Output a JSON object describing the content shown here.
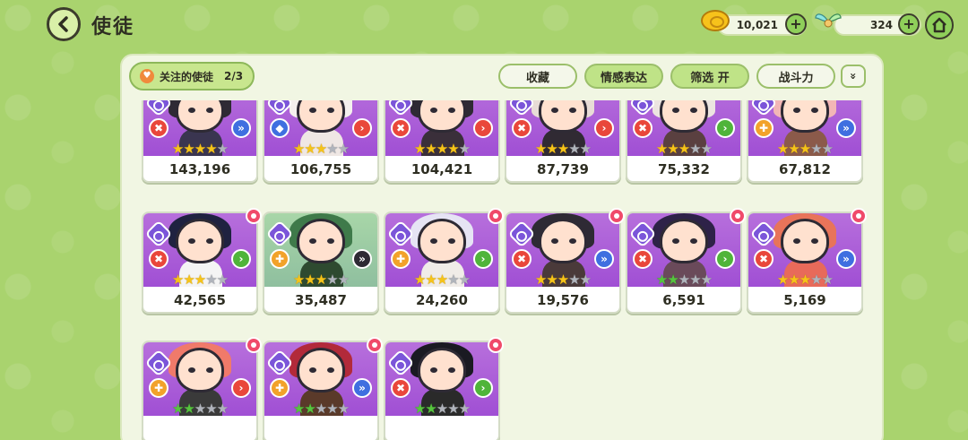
{
  "header": {
    "title": "使徒",
    "coins": "10,021",
    "gems": "324",
    "plus_label": "+"
  },
  "toolbar": {
    "follow_label": "关注的使徒",
    "follow_count": "2/3",
    "favorites_label": "收藏",
    "emotion_label": "情感表达",
    "filter_label": "筛选 开",
    "power_label": "战斗力",
    "collapse_label": "»"
  },
  "colors": {
    "accent_green": "#a9d36e",
    "card_purple": "#a04fd4",
    "star_gold": "#f6c419",
    "star_green": "#56c43e"
  },
  "cards": [
    {
      "power": "143,196",
      "stars_filled": 4,
      "star_color": "gold",
      "role": "atk",
      "arrow": "blue",
      "hair": "#2e2a34",
      "body": "#3a3550",
      "flower": false
    },
    {
      "power": "106,755",
      "stars_filled": 3,
      "star_color": "gold",
      "role": "def",
      "arrow": "red",
      "hair": "#f4f0ee",
      "body": "#efe7e4",
      "flower": false
    },
    {
      "power": "104,421",
      "stars_filled": 4,
      "star_color": "gold",
      "role": "atk",
      "arrow": "red",
      "hair": "#2e2a34",
      "body": "#3a2f3a",
      "flower": false
    },
    {
      "power": "87,739",
      "stars_filled": 3,
      "star_color": "gold",
      "role": "atk",
      "arrow": "red",
      "hair": "#e8dcd6",
      "body": "#302a33",
      "flower": false
    },
    {
      "power": "75,332",
      "stars_filled": 3,
      "star_color": "gold",
      "role": "atk",
      "arrow": "green",
      "hair": "#ece4e0",
      "body": "#5a4040",
      "flower": false
    },
    {
      "power": "67,812",
      "stars_filled": 3,
      "star_color": "gold",
      "role": "sup",
      "arrow": "blue",
      "hair": "#f2b6b6",
      "body": "#8b5a4a",
      "flower": false
    },
    {
      "power": "42,565",
      "stars_filled": 3,
      "star_color": "gold",
      "role": "atk",
      "arrow": "green",
      "hair": "#1f2240",
      "body": "#f4f4f4",
      "flower": true
    },
    {
      "power": "35,487",
      "stars_filled": 3,
      "star_color": "gold",
      "role": "sup",
      "arrow": "dark",
      "hair": "#3f7a4a",
      "body": "#2e4a30",
      "flower": false,
      "green_bg": true
    },
    {
      "power": "24,260",
      "stars_filled": 3,
      "star_color": "gold",
      "role": "sup",
      "arrow": "green",
      "hair": "#e6e4f4",
      "body": "#f0ece8",
      "flower": true
    },
    {
      "power": "19,576",
      "stars_filled": 3,
      "star_color": "gold",
      "role": "atk",
      "arrow": "blue",
      "hair": "#2e2a34",
      "body": "#4a3a3a",
      "flower": true
    },
    {
      "power": "6,591",
      "stars_filled": 2,
      "star_color": "green",
      "role": "atk",
      "arrow": "green",
      "hair": "#2e2248",
      "body": "#6a4a5a",
      "flower": true
    },
    {
      "power": "5,169",
      "stars_filled": 3,
      "star_color": "gold",
      "role": "atk",
      "arrow": "blue",
      "hair": "#e8745a",
      "body": "#e86a5a",
      "flower": true
    },
    {
      "power": "",
      "stars_filled": 2,
      "star_color": "green",
      "role": "sup",
      "arrow": "red",
      "hair": "#f07a6a",
      "body": "#3a3a3a",
      "flower": true
    },
    {
      "power": "",
      "stars_filled": 2,
      "star_color": "green",
      "role": "sup",
      "arrow": "blue",
      "hair": "#b22a3a",
      "body": "#5a3a2a",
      "flower": true
    },
    {
      "power": "",
      "stars_filled": 2,
      "star_color": "green",
      "role": "atk",
      "arrow": "green",
      "hair": "#1a1a22",
      "body": "#2a2a2a",
      "flower": true
    }
  ]
}
